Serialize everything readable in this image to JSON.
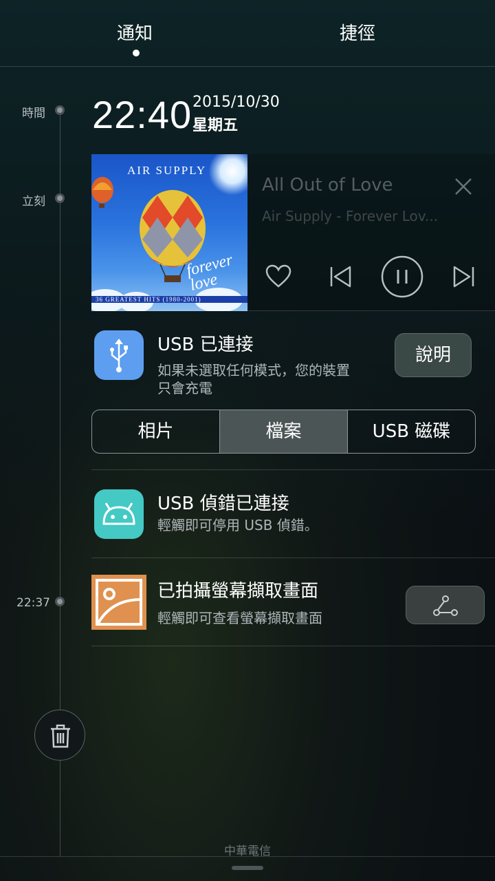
{
  "tabs": {
    "notifications": "通知",
    "shortcuts": "捷徑"
  },
  "timeline": {
    "time_label": "時間",
    "now_label": "立刻",
    "earlier_label": "22:37"
  },
  "clock": {
    "time": "22:40",
    "date": "2015/10/30",
    "weekday": "星期五"
  },
  "music": {
    "song": "All Out of Love",
    "artist": "Air Supply - Forever Lov...",
    "album_art": {
      "title": "AIR SUPPLY",
      "script": "forever love",
      "subtitle": "36 GREATEST HITS (1980-2001)"
    }
  },
  "usb": {
    "title": "USB 已連接",
    "body_line1": "如果未選取任何模式，您的裝置",
    "body_line2": "只會充電",
    "help_label": "說明",
    "modes": [
      "相片",
      "檔案",
      "USB 磁碟"
    ],
    "selected_mode": "檔案"
  },
  "usb_debug": {
    "title": "USB 偵錯已連接",
    "body": "輕觸即可停用 USB 偵錯。"
  },
  "screenshot": {
    "title": "已拍攝螢幕擷取畫面",
    "body": "輕觸即可查看螢幕擷取畫面"
  },
  "footer": {
    "carrier": "中華電信"
  },
  "colors": {
    "usb_icon": "#5d9ef0",
    "android_icon": "#44c9c4",
    "screenshot_icon": "#e0914f",
    "selected_segment": "#4c5556"
  },
  "icons": [
    "usb-icon",
    "android-icon",
    "screenshot-icon",
    "close-icon",
    "heart-icon",
    "previous-icon",
    "pause-icon",
    "next-icon",
    "share-icon",
    "trash-icon"
  ]
}
